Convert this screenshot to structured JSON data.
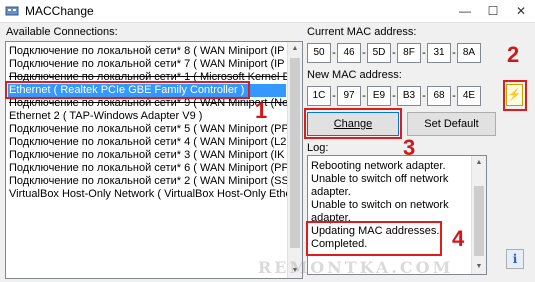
{
  "window": {
    "title": "MACChange",
    "min_glyph": "—",
    "max_glyph": "☐",
    "close_glyph": "✕"
  },
  "connections": {
    "label": "Available Connections:",
    "items": [
      {
        "text": "Подключение по локальной сети* 8 ( WAN Miniport (IP",
        "strike": false,
        "selected": false
      },
      {
        "text": "Подключение по локальной сети* 7 ( WAN Miniport (IP",
        "strike": false,
        "selected": false
      },
      {
        "text": "Подключение по локальной сети* 1 ( Microsoft Kernel D",
        "strike": true,
        "selected": false
      },
      {
        "text": "Ethernet ( Realtek PCIe GBE Family Controller )",
        "strike": false,
        "selected": true
      },
      {
        "text": "Подключение по локальной сети* 9 ( WAN Miniport (Ne",
        "strike": true,
        "selected": false
      },
      {
        "text": "Ethernet 2 ( TAP-Windows Adapter V9 )",
        "strike": false,
        "selected": false
      },
      {
        "text": "Подключение по локальной сети* 5 ( WAN Miniport (PP",
        "strike": false,
        "selected": false
      },
      {
        "text": "Подключение по локальной сети* 4 ( WAN Miniport (L2",
        "strike": false,
        "selected": false
      },
      {
        "text": "Подключение по локальной сети* 3 ( WAN Miniport (IK",
        "strike": false,
        "selected": false
      },
      {
        "text": "Подключение по локальной сети* 6 ( WAN Miniport (PP",
        "strike": false,
        "selected": false
      },
      {
        "text": "Подключение по локальной сети* 2 ( WAN Miniport (SS",
        "strike": false,
        "selected": false
      },
      {
        "text": "VirtualBox Host-Only Network ( VirtualBox Host-Only Ethe",
        "strike": false,
        "selected": false
      }
    ]
  },
  "current_mac": {
    "label": "Current MAC address:",
    "octets": [
      "50",
      "46",
      "5D",
      "8F",
      "31",
      "8A"
    ]
  },
  "new_mac": {
    "label": "New MAC address:",
    "octets": [
      "1C",
      "97",
      "E9",
      "B3",
      "68",
      "4E"
    ]
  },
  "separator": "-",
  "generate_icon": "⚡",
  "buttons": {
    "change": "Change",
    "set_default": "Set Default"
  },
  "log": {
    "label": "Log:",
    "lines": [
      "Rebooting network adapter.",
      "Unable to switch off network",
      "adapter.",
      "Unable to switch on network",
      "adapter.",
      "Updating MAC addresses.",
      "Completed."
    ]
  },
  "info_icon": "i",
  "annotations": [
    "1",
    "2",
    "3",
    "4"
  ],
  "watermark": "REMONTKA.COM",
  "colors": {
    "selection": "#3399ff",
    "annotation": "#e01b1b"
  }
}
